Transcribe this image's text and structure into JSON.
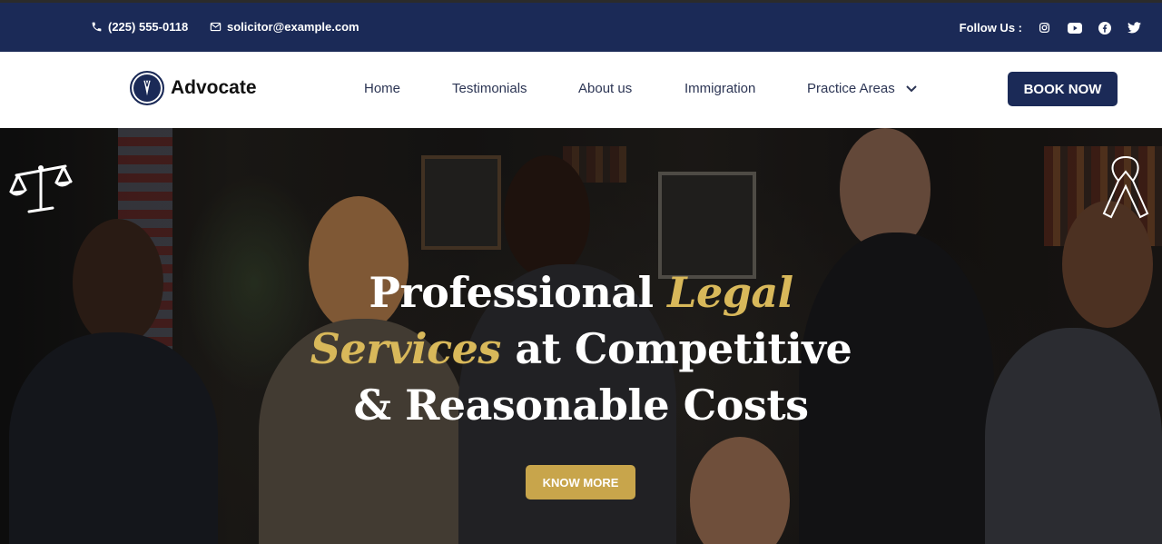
{
  "topbar": {
    "phone": "(225) 555-0118",
    "email": "solicitor@example.com",
    "follow_label": "Follow Us :",
    "socials": [
      "instagram-icon",
      "youtube-icon",
      "facebook-icon",
      "twitter-icon"
    ]
  },
  "header": {
    "logo_text": "Advocate",
    "nav": [
      "Home",
      "Testimonials",
      "About us",
      "Immigration",
      "Practice Areas"
    ],
    "cta": "BOOK NOW"
  },
  "hero": {
    "line1_plain": "Professional ",
    "line1_accent": "Legal",
    "line2_accent": "Services",
    "line2_plain": " at Competitive",
    "line3": "& Reasonable Costs",
    "button": "KNOW MORE"
  },
  "colors": {
    "navy": "#1b2a57",
    "gold": "#c8a54b",
    "accent_text": "#d8b85a"
  }
}
